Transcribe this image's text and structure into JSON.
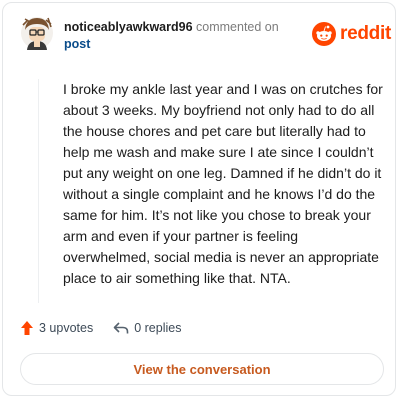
{
  "header": {
    "username": "noticeablyawkward96",
    "commented_on": "commented on",
    "post_link": "post"
  },
  "brand": {
    "logo_text": "reddit",
    "color": "#ff4500"
  },
  "comment": {
    "body": "I broke my ankle last year and I was on crutches for about 3 weeks. My boyfriend not only had to do all the house chores and pet care but literally had to help me wash and make sure I ate since I couldn’t put any weight on one leg. Damned if he didn’t do it without a single complaint and he knows I’d do the same for him. It’s not like you chose to break your arm and even if your partner is feeling overwhelmed, social media is never an appropriate place to air something like that. NTA."
  },
  "actions": {
    "upvotes": "3 upvotes",
    "replies": "0 replies"
  },
  "footer": {
    "view_button": "View the conversation",
    "accent_color": "#c75a1f"
  },
  "icons": {
    "avatar": "cartoon-avatar",
    "upvote": "upvote-arrow-icon",
    "reply": "reply-arrow-icon",
    "logo": "reddit-alien-icon"
  }
}
